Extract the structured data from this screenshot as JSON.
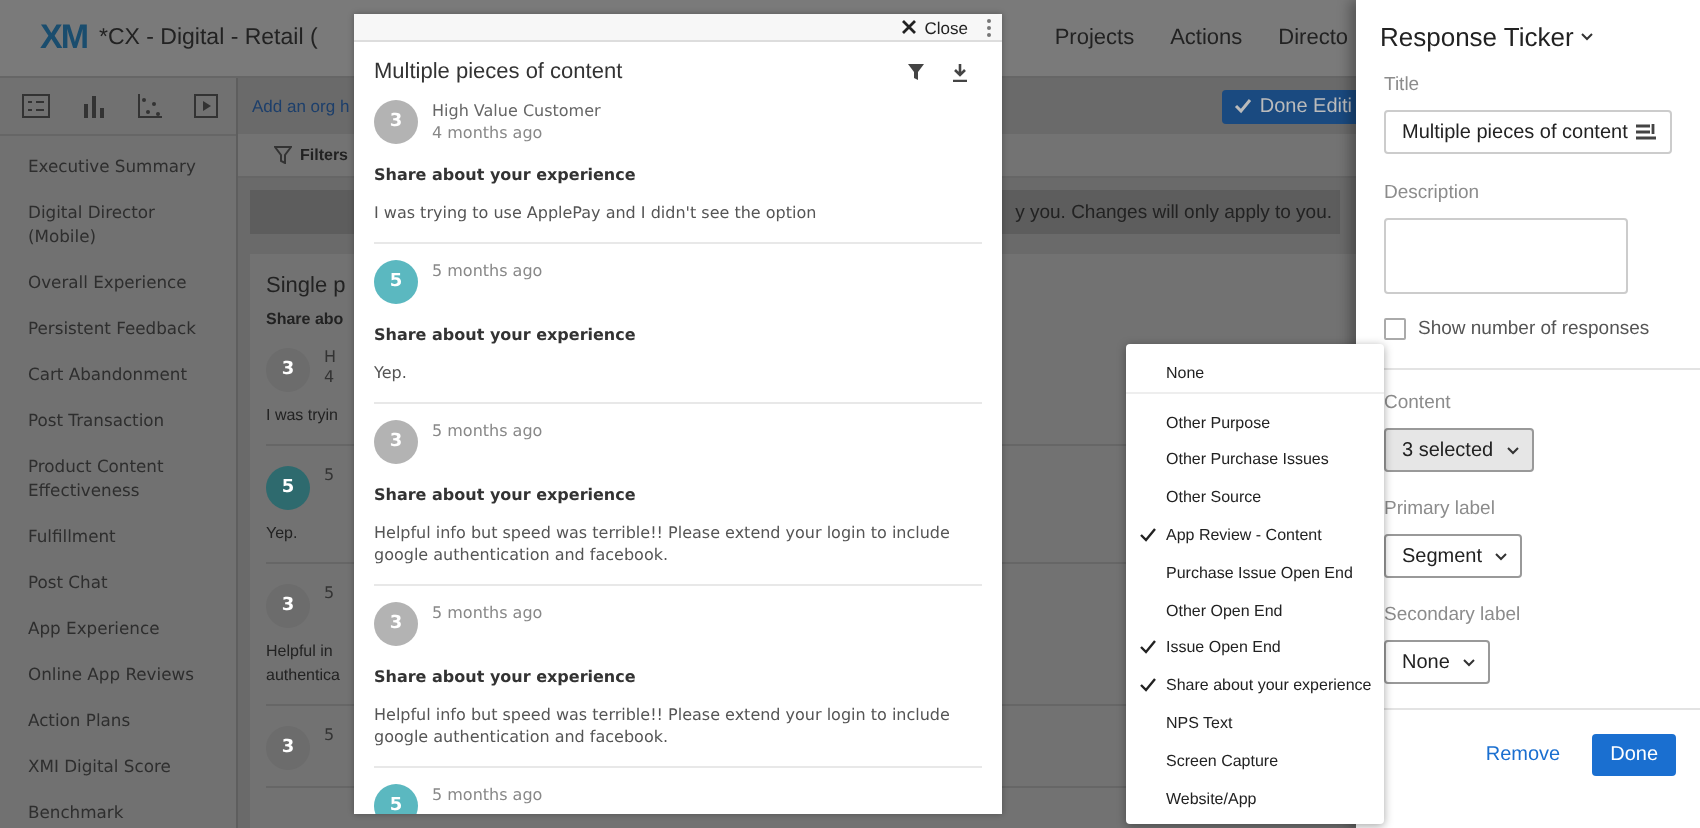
{
  "header": {
    "logo": "XM",
    "title": "*CX - Digital - Retail (",
    "nav": [
      "Projects",
      "Actions",
      "Directo"
    ]
  },
  "sidebar": {
    "items": [
      {
        "label": "Executive Summary",
        "selected": false
      },
      {
        "label": "Digital Director (Mobile)",
        "selected": false
      },
      {
        "label": "Overall Experience",
        "selected": false
      },
      {
        "label": "Persistent Feedback",
        "selected": false
      },
      {
        "label": "Cart Abandonment",
        "selected": false
      },
      {
        "label": "Post Transaction",
        "selected": false
      },
      {
        "label": "Product Content Effectiveness",
        "selected": false
      },
      {
        "label": "Fulfillment",
        "selected": false
      },
      {
        "label": "Post Chat",
        "selected": false
      },
      {
        "label": "App Experience",
        "selected": false
      },
      {
        "label": "Online App Reviews",
        "selected": false
      },
      {
        "label": "Action Plans",
        "selected": false
      },
      {
        "label": "XMI Digital Score",
        "selected": false
      },
      {
        "label": "Benchmark",
        "selected": false
      }
    ]
  },
  "toolbar": {
    "org_link": "Add an org h",
    "done_button": "Done Editi",
    "filters": "Filters",
    "banner": "y you. Changes will only apply to you."
  },
  "background_card": {
    "title": "Single p",
    "question": "Share abo",
    "entries": [
      {
        "score": "3",
        "color": "#6c6c6c",
        "meta": [
          "H",
          "4"
        ],
        "text": "I was tryin"
      },
      {
        "score": "5",
        "color": "#2e6a6e",
        "meta": [
          "5"
        ],
        "text": "Yep."
      },
      {
        "score": "3",
        "color": "#6c6c6c",
        "meta": [
          "5"
        ],
        "text": "Helpful in authentica"
      },
      {
        "score": "3",
        "color": "#6c6c6c",
        "meta": [
          "5"
        ]
      }
    ]
  },
  "modal": {
    "close": "Close",
    "title": "Multiple pieces of content",
    "responses": [
      {
        "score": "3",
        "color": "#b3b3b3",
        "name": "High Value Customer",
        "time": "4 months ago",
        "question": "Share about your experience",
        "answer": "I was trying to use ApplePay and I didn't see the option"
      },
      {
        "score": "5",
        "color": "#5bb8c0",
        "time": "5 months ago",
        "question": "Share about your experience",
        "answer": "Yep."
      },
      {
        "score": "3",
        "color": "#b3b3b3",
        "time": "5 months ago",
        "question": "Share about your experience",
        "answer": "Helpful info but speed was terrible!! Please extend your login to include google authentication and facebook."
      },
      {
        "score": "3",
        "color": "#b3b3b3",
        "time": "5 months ago",
        "question": "Share about your experience",
        "answer": "Helpful info but speed was terrible!! Please extend your login to include google authentication and facebook."
      },
      {
        "score": "5",
        "color": "#5bb8c0",
        "time": "5 months ago"
      }
    ]
  },
  "menu": {
    "items": [
      {
        "label": "None",
        "checked": false
      },
      {
        "label": "Other Purpose",
        "checked": false
      },
      {
        "label": "Other Purchase Issues",
        "checked": false
      },
      {
        "label": "Other Source",
        "checked": false
      },
      {
        "label": "App Review - Content",
        "checked": true
      },
      {
        "label": "Purchase Issue Open End",
        "checked": false
      },
      {
        "label": "Other Open End",
        "checked": false
      },
      {
        "label": "Issue Open End",
        "checked": true
      },
      {
        "label": "Share about your experience",
        "checked": true
      },
      {
        "label": "NPS Text",
        "checked": false
      },
      {
        "label": "Screen Capture",
        "checked": false
      },
      {
        "label": "Website/App",
        "checked": false
      }
    ]
  },
  "panel": {
    "title": "Response Ticker",
    "title_label": "Title",
    "title_value": "Multiple pieces of content",
    "description_label": "Description",
    "show_count": {
      "label": "Show number of responses",
      "checked": false
    },
    "selects": [
      {
        "label": "Content",
        "value": "3 selected",
        "open": true
      },
      {
        "label": "Primary label",
        "value": "Segment",
        "open": false
      },
      {
        "label": "Secondary label",
        "value": "None",
        "open": false
      }
    ],
    "remove": "Remove",
    "done": "Done"
  }
}
